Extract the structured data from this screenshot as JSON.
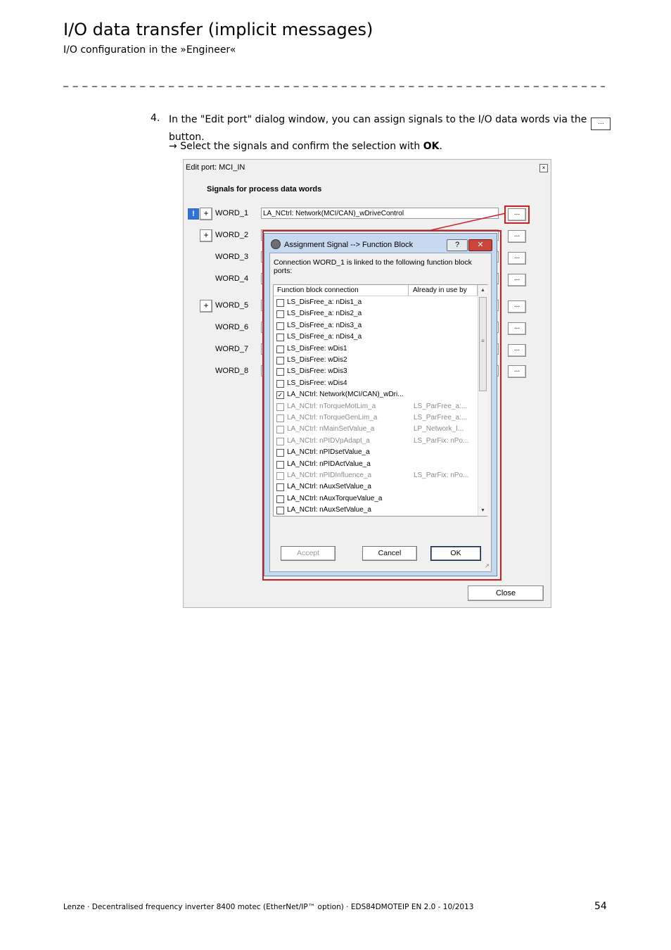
{
  "header": {
    "title": "I/O data transfer (implicit messages)",
    "subtitle": "I/O configuration in the »Engineer«",
    "separator": "_ _ _ _ _ _ _ _ _ _ _ _ _ _ _ _ _ _ _ _ _ _ _ _ _ _ _ _ _ _ _ _ _ _ _ _ _ _ _ _ _ _ _ _ _ _ _ _ _ _ _ _ _ _ _ _ _ _ _ _ _ _ _ _"
  },
  "step": {
    "number": "4.",
    "text": "In the \"Edit port\" dialog window, you can assign signals to the I/O data words via the",
    "button_glyph": "...",
    "text_end": "button.",
    "arrow": "→",
    "result_text": "Select the signals and confirm the selection with",
    "result_bold": "OK",
    "result_end": "."
  },
  "edit_port": {
    "title": "Edit port: MCI_IN",
    "close_glyph": "×",
    "section_label": "Signals for process data words",
    "warning_glyph": "!",
    "plus_glyph": "+",
    "dots_glyph": "...",
    "words": [
      "WORD_1",
      "WORD_2",
      "WORD_3",
      "WORD_4",
      "WORD_5",
      "WORD_6",
      "WORD_7",
      "WORD_8"
    ],
    "word1_value": "LA_NCtrl: Network(MCI/CAN)_wDriveControl",
    "close_button": "Close"
  },
  "assignment_dialog": {
    "title": "Assignment Signal --> Function Block",
    "help_glyph": "?",
    "close_glyph": "✕",
    "description": "Connection WORD_1 is linked to the following function block ports:",
    "col_connection": "Function block connection",
    "col_used_by": "Already in use by",
    "rows": [
      {
        "label": "LS_DisFree_a: nDis1_a",
        "used_by": "",
        "checked": false,
        "disabled": false
      },
      {
        "label": "LS_DisFree_a: nDis2_a",
        "used_by": "",
        "checked": false,
        "disabled": false
      },
      {
        "label": "LS_DisFree_a: nDis3_a",
        "used_by": "",
        "checked": false,
        "disabled": false
      },
      {
        "label": "LS_DisFree_a: nDis4_a",
        "used_by": "",
        "checked": false,
        "disabled": false
      },
      {
        "label": "LS_DisFree: wDis1",
        "used_by": "",
        "checked": false,
        "disabled": false
      },
      {
        "label": "LS_DisFree: wDis2",
        "used_by": "",
        "checked": false,
        "disabled": false
      },
      {
        "label": "LS_DisFree: wDis3",
        "used_by": "",
        "checked": false,
        "disabled": false
      },
      {
        "label": "LS_DisFree: wDis4",
        "used_by": "",
        "checked": false,
        "disabled": false
      },
      {
        "label": "LA_NCtrl: Network(MCI/CAN)_wDri...",
        "used_by": "",
        "checked": true,
        "disabled": false
      },
      {
        "label": "LA_NCtrl: nTorqueMotLim_a",
        "used_by": "LS_ParFree_a:...",
        "checked": false,
        "disabled": true
      },
      {
        "label": "LA_NCtrl: nTorqueGenLim_a",
        "used_by": "LS_ParFree_a:...",
        "checked": false,
        "disabled": true
      },
      {
        "label": "LA_NCtrl: nMainSetValue_a",
        "used_by": "LP_Network_I...",
        "checked": false,
        "disabled": true
      },
      {
        "label": "LA_NCtrl: nPIDVpAdapt_a",
        "used_by": "LS_ParFix: nPo...",
        "checked": false,
        "disabled": true
      },
      {
        "label": "LA_NCtrl: nPIDsetValue_a",
        "used_by": "",
        "checked": false,
        "disabled": false
      },
      {
        "label": "LA_NCtrl: nPIDActValue_a",
        "used_by": "",
        "checked": false,
        "disabled": false
      },
      {
        "label": "LA_NCtrl: nPIDInfluence_a",
        "used_by": "LS_ParFix: nPo...",
        "checked": false,
        "disabled": true
      },
      {
        "label": "LA_NCtrl: nAuxSetValue_a",
        "used_by": "",
        "checked": false,
        "disabled": false
      },
      {
        "label": "LA_NCtrl: nAuxTorqueValue_a",
        "used_by": "",
        "checked": false,
        "disabled": false
      },
      {
        "label": "LA_NCtrl: nAuxSetValue_a",
        "used_by": "",
        "checked": false,
        "disabled": false
      }
    ],
    "scroll_up": "▲",
    "scroll_down": "▼",
    "scroll_grip": "≡",
    "accept_button": "Accept",
    "cancel_button": "Cancel",
    "ok_button": "OK",
    "resize_glyph": "↗"
  },
  "colors": {
    "highlight": "#cc1f24",
    "dialog_frame": "#c7d9ee"
  },
  "footer": {
    "text": "Lenze · Decentralised frequency inverter 8400 motec (EtherNet/IP™ option) · EDS84DMOTEIP EN 2.0 - 10/2013",
    "page": "54"
  }
}
